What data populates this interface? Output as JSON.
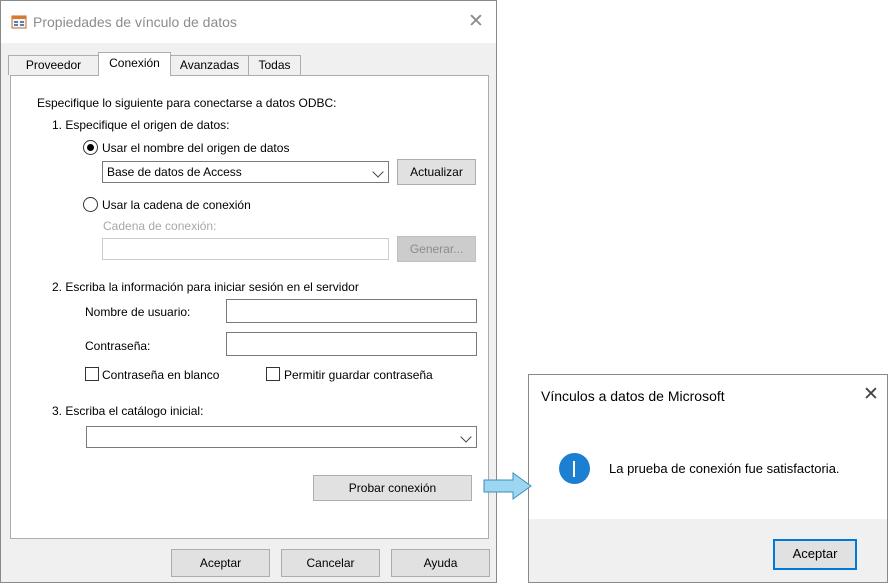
{
  "main_dialog": {
    "title": "Propiedades de vínculo de datos",
    "tabs": [
      "Proveedor",
      "Conexión",
      "Avanzadas",
      "Todas"
    ],
    "active_tab": "Conexión",
    "intro": "Especifique lo siguiente para conectarse a datos ODBC:",
    "step1": {
      "heading": "1. Especifique el origen de datos:",
      "radio_dsn_label": "Usar el nombre del origen de datos",
      "dsn_value": "Base de datos de Access",
      "refresh_button": "Actualizar",
      "radio_connstr_label": "Usar la cadena de conexión",
      "connstr_label": "Cadena de conexión:",
      "connstr_value": "",
      "build_button": "Generar..."
    },
    "step2": {
      "heading": "2. Escriba la información para iniciar sesión en el servidor",
      "username_label": "Nombre de usuario:",
      "username_value": "",
      "password_label": "Contraseña:",
      "password_value": "",
      "blank_password_label": "Contraseña en blanco",
      "save_password_label": "Permitir guardar contraseña"
    },
    "step3": {
      "heading": "3. Escriba el catálogo inicial:",
      "catalog_value": ""
    },
    "test_button": "Probar conexión",
    "ok_button": "Aceptar",
    "cancel_button": "Cancelar",
    "help_button": "Ayuda"
  },
  "message_box": {
    "title": "Vínculos a datos de Microsoft",
    "icon": "info-icon",
    "message": "La prueba de conexión fue satisfactoria.",
    "ok_button": "Aceptar"
  },
  "colors": {
    "dialog_bg": "#f0f0f0",
    "button_bg": "#e1e1e1",
    "focus_border": "#0078d7",
    "info_icon": "#1c7fd1",
    "arrow_fill": "#9dd6f0"
  }
}
